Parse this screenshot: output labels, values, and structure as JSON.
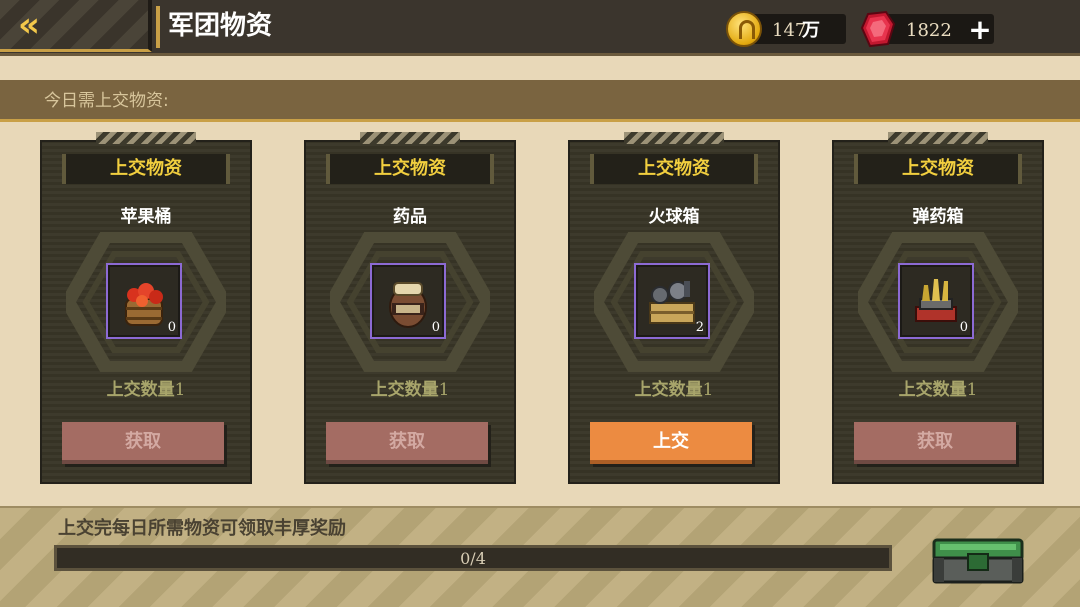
{
  "header": {
    "title": "军团物资",
    "back_icon": "double-chevron-left-icon",
    "gold": {
      "value": "147",
      "unit": "万",
      "icon": "gold-coin-icon"
    },
    "gems": {
      "value": "1822",
      "icon": "red-gem-icon"
    },
    "add_label": "+"
  },
  "banner": {
    "text": "今日需上交物资:"
  },
  "cards": [
    {
      "header": "上交物资",
      "name": "苹果桶",
      "count": "0",
      "qty_label": "上交数量",
      "qty": "1",
      "button": "获取",
      "active": false,
      "icon": "apple-barrel-icon"
    },
    {
      "header": "上交物资",
      "name": "药品",
      "count": "0",
      "qty_label": "上交数量",
      "qty": "1",
      "button": "获取",
      "active": false,
      "icon": "medicine-jar-icon"
    },
    {
      "header": "上交物资",
      "name": "火球箱",
      "count": "2",
      "qty_label": "上交数量",
      "qty": "1",
      "button": "上交",
      "active": true,
      "icon": "fireball-crate-icon"
    },
    {
      "header": "上交物资",
      "name": "弹药箱",
      "count": "0",
      "qty_label": "上交数量",
      "qty": "1",
      "button": "获取",
      "active": false,
      "icon": "ammo-box-icon"
    }
  ],
  "footer": {
    "text": "上交完每日所需物资可领取丰厚奖励",
    "progress_text": "0/4",
    "progress_fraction": 0,
    "chest_icon": "reward-chest-icon"
  },
  "colors": {
    "accent_gold": "#f2cf3f",
    "button_disabled": "#a46c63",
    "button_active": "#ec8b41",
    "item_border": "#8c6ad4"
  }
}
